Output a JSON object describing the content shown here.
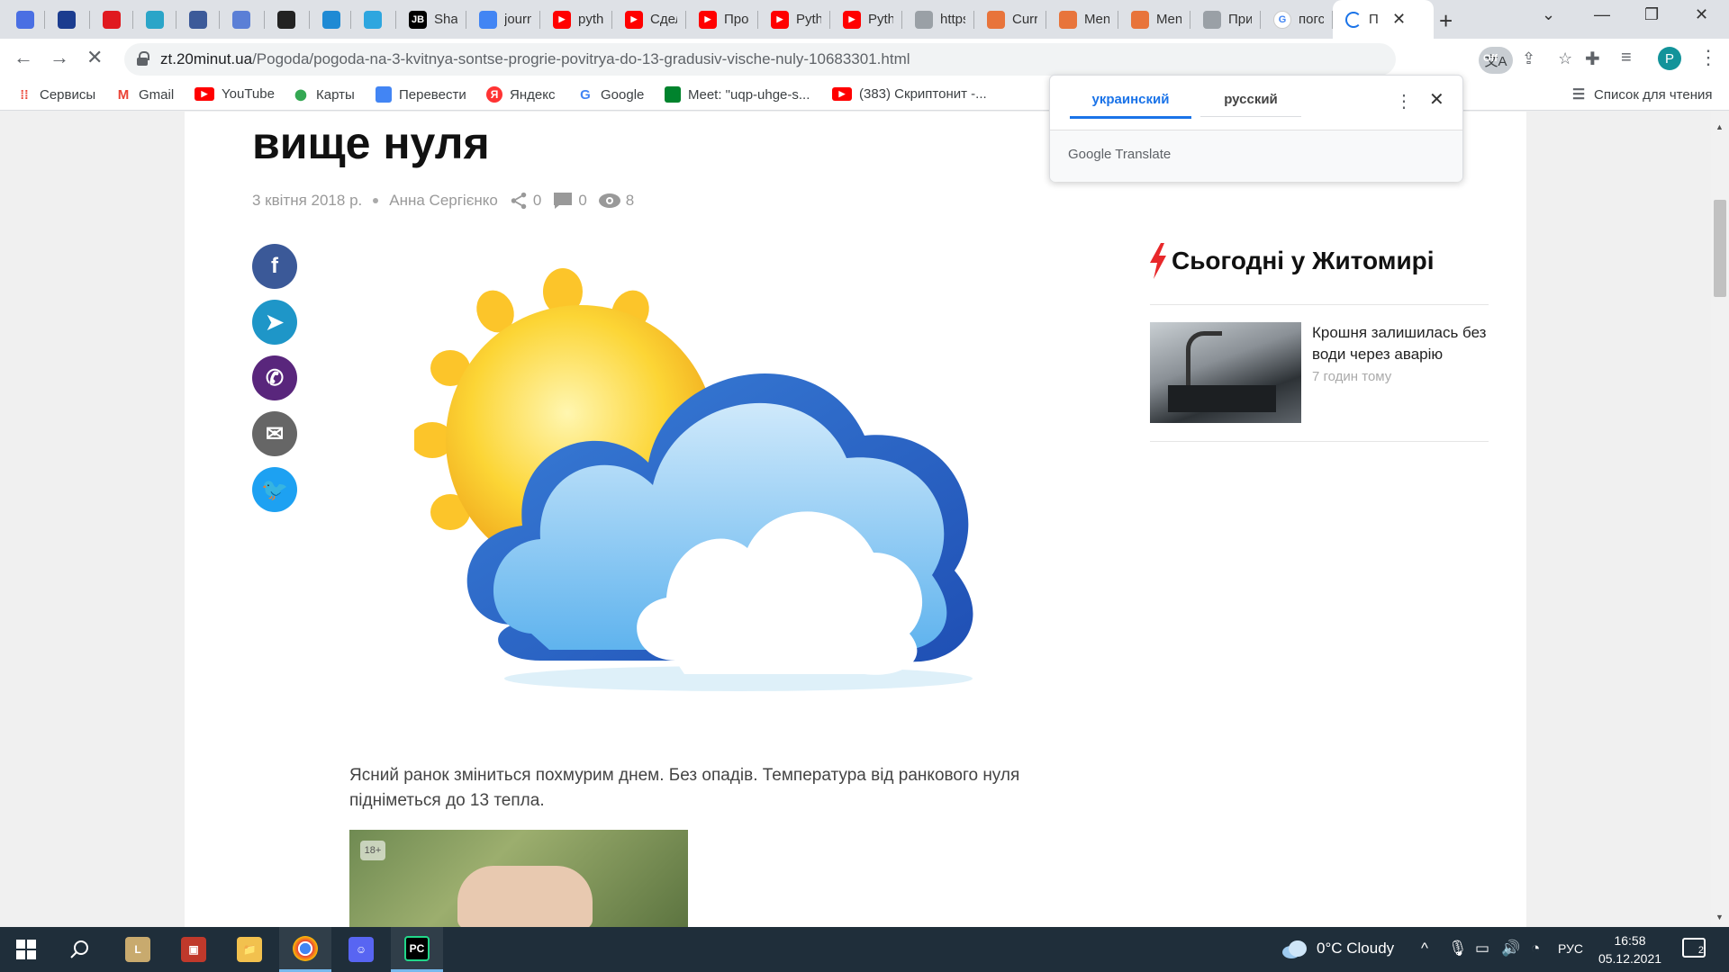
{
  "browser": {
    "tabs": [
      {
        "title": "",
        "icon": "mail-icon",
        "color": "#4a6fe3"
      },
      {
        "title": "",
        "icon": "ukraine-emblem-icon",
        "color": "#1b3c8f"
      },
      {
        "title": "",
        "icon": "opera-icon",
        "color": "#e0191f"
      },
      {
        "title": "",
        "icon": "zoom-stack-icon",
        "color": "#2ba5c8"
      },
      {
        "title": "",
        "icon": "book-icon",
        "color": "#3c5a99"
      },
      {
        "title": "",
        "icon": "glasses-icon",
        "color": "#5b7fd6"
      },
      {
        "title": "",
        "icon": "tc-logo-icon",
        "color": "#222222"
      },
      {
        "title": "",
        "icon": "c-logo-icon",
        "color": "#1f8ad4"
      },
      {
        "title": "",
        "icon": "telegram-icon",
        "color": "#2ea6df"
      },
      {
        "title": "Shar",
        "icon": "jetbrains-icon",
        "color": "#000000"
      },
      {
        "title": "journ",
        "icon": "docs-icon",
        "color": "#4285f4"
      },
      {
        "title": "pyth",
        "icon": "youtube-icon",
        "color": "#ff0000"
      },
      {
        "title": "Сдел",
        "icon": "youtube-icon",
        "color": "#ff0000"
      },
      {
        "title": "Прог",
        "icon": "youtube-icon",
        "color": "#ff0000"
      },
      {
        "title": "Pyth",
        "icon": "youtube-icon",
        "color": "#ff0000"
      },
      {
        "title": "Pyth",
        "icon": "youtube-icon",
        "color": "#ff0000"
      },
      {
        "title": "https",
        "icon": "globe-icon",
        "color": "#9aa0a6"
      },
      {
        "title": "Curr",
        "icon": "hat-icon",
        "color": "#e8743b"
      },
      {
        "title": "Men",
        "icon": "hat-icon",
        "color": "#e8743b"
      },
      {
        "title": "Men",
        "icon": "hat-icon",
        "color": "#e8743b"
      },
      {
        "title": "При",
        "icon": "globe-icon",
        "color": "#9aa0a6"
      },
      {
        "title": "погс",
        "icon": "google-icon",
        "color": "#ffffff"
      },
      {
        "title": "П",
        "icon": "loading-icon",
        "color": "#1a73e8",
        "active": true
      }
    ],
    "url_host": "zt.20minut.ua",
    "url_path": "/Pogoda/pogoda-na-3-kvitnya-sontse-progrie-povitrya-do-13-gradusiv-vische-nuly-10683301.html",
    "extensions": [
      {
        "name": "off-extension-icon",
        "label": "Off",
        "color": "#555555"
      },
      {
        "name": "binance-extension-icon",
        "label": "◆",
        "color": "#1e1e1e"
      },
      {
        "name": "metamask-extension-icon",
        "label": "▲",
        "color": "#e2761b"
      }
    ],
    "profile_initial": "P"
  },
  "bookmarks": {
    "items": [
      {
        "label": "Сервисы",
        "icon": "apps-grid-icon",
        "color": "#ea4335"
      },
      {
        "label": "Gmail",
        "icon": "gmail-icon",
        "color": "#ea4335"
      },
      {
        "label": "YouTube",
        "icon": "youtube-icon",
        "color": "#ff0000"
      },
      {
        "label": "Карты",
        "icon": "maps-pin-icon",
        "color": "#34a853"
      },
      {
        "label": "Перевести",
        "icon": "translate-icon",
        "color": "#4285f4"
      },
      {
        "label": "Яндекс",
        "icon": "yandex-icon",
        "color": "#ff3333"
      },
      {
        "label": "Google",
        "icon": "google-icon",
        "color": "#4285f4"
      },
      {
        "label": "Meet: \"uqp-uhge-s...",
        "icon": "meet-icon",
        "color": "#00832d"
      },
      {
        "label": "(383) Скриптонит -...",
        "icon": "youtube-icon",
        "color": "#ff0000"
      }
    ],
    "reading_list": "Список для чтения"
  },
  "article": {
    "title": "вище нуля",
    "date": "3 квітня 2018 р.",
    "author": "Анна Сергієнко",
    "shares": "0",
    "comments": "0",
    "views": "8",
    "body": "Ясний ранок зміниться похмурим днем. Без опадів. Температура від ранкового нуля підніметься до 13 тепла.",
    "ad_badge": "18+",
    "share_buttons": [
      {
        "name": "facebook-share-button",
        "icon": "facebook-icon",
        "glyph": "f",
        "color": "#3b5998"
      },
      {
        "name": "telegram-share-button",
        "icon": "telegram-icon",
        "glyph": "➤",
        "color": "#1e96c8"
      },
      {
        "name": "viber-share-button",
        "icon": "viber-icon",
        "glyph": "✆",
        "color": "#59267c"
      },
      {
        "name": "email-share-button",
        "icon": "email-icon",
        "glyph": "✉",
        "color": "#666666"
      },
      {
        "name": "twitter-share-button",
        "icon": "twitter-icon",
        "glyph": "🐦",
        "color": "#1da1f2"
      }
    ]
  },
  "sidebar": {
    "title": "Сьогодні у Житомирі",
    "news": [
      {
        "headline": "Крошня залишилась без води через аварію",
        "time": "7 годин тому"
      }
    ]
  },
  "translate_popup": {
    "tab_active": "украинский",
    "tab_inactive": "русский",
    "brand": "Google Translate"
  },
  "taskbar": {
    "apps": [
      {
        "name": "league-of-legends-taskbar",
        "label": "L",
        "color": "#c8aa6e"
      },
      {
        "name": "app-red-blue-taskbar",
        "label": "▣",
        "color": "#c0392b"
      },
      {
        "name": "file-explorer-taskbar",
        "label": "📁",
        "color": "#f2c14e"
      },
      {
        "name": "chrome-taskbar",
        "label": "●",
        "color": "#4285f4",
        "running": true
      },
      {
        "name": "discord-taskbar",
        "label": "☺",
        "color": "#5865f2"
      },
      {
        "name": "pycharm-taskbar",
        "label": "PC",
        "color": "#21d789",
        "running": true
      }
    ],
    "weather": "0°C  Cloudy",
    "language": "РУС",
    "time": "16:58",
    "date": "05.12.2021",
    "notifications": "2"
  }
}
